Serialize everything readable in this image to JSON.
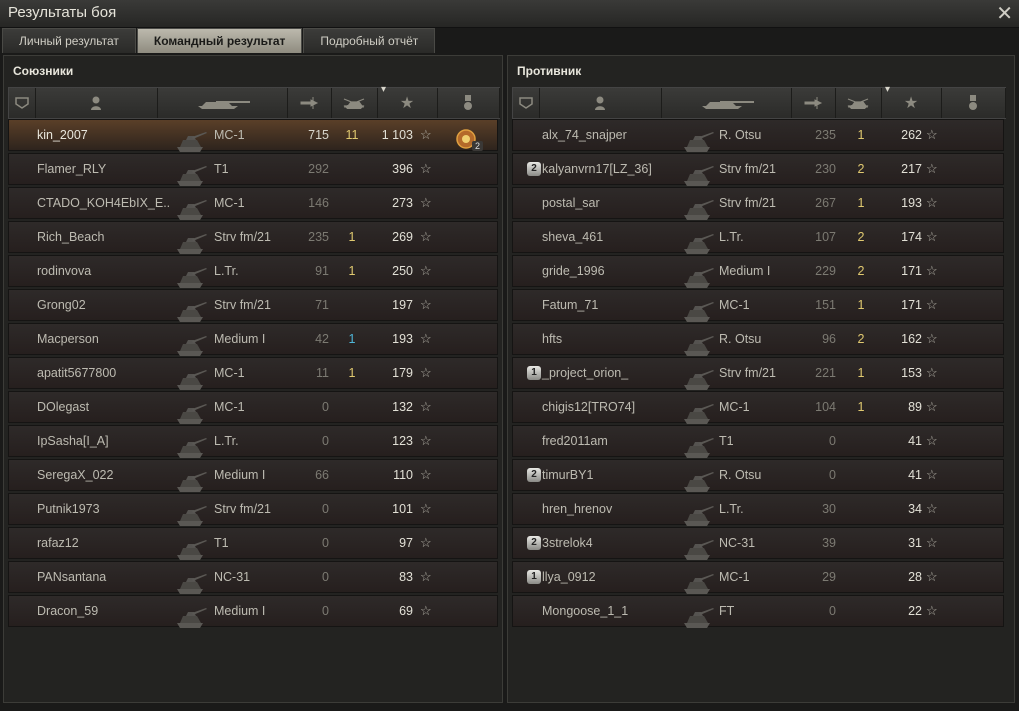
{
  "window": {
    "title": "Результаты боя"
  },
  "tabs": [
    {
      "label": "Личный результат",
      "active": false
    },
    {
      "label": "Командный результат",
      "active": true
    },
    {
      "label": "Подробный отчёт",
      "active": false
    }
  ],
  "allies": {
    "title": "Союзники",
    "rows": [
      {
        "name": "kin_2007",
        "tank": "MC-1",
        "damage": "715",
        "kills": "11",
        "xp": "1 103",
        "highlight": true,
        "medal_count": "2"
      },
      {
        "name": "Flamer_RLY",
        "tank": "T1",
        "damage": "292",
        "kills": "",
        "xp": "396"
      },
      {
        "name": "CTADO_KOH4EbIX_E..",
        "tank": "MC-1",
        "damage": "146",
        "kills": "",
        "xp": "273"
      },
      {
        "name": "Rich_Beach",
        "tank": "Strv fm/21",
        "damage": "235",
        "kills": "1",
        "xp": "269"
      },
      {
        "name": "rodinvova",
        "tank": "L.Tr.",
        "damage": "91",
        "kills": "1",
        "xp": "250"
      },
      {
        "name": "Grong02",
        "tank": "Strv fm/21",
        "damage": "71",
        "kills": "",
        "xp": "197"
      },
      {
        "name": "Macperson",
        "tank": "Medium I",
        "damage": "42",
        "kills": "1",
        "xp": "193",
        "kills_cyan": true
      },
      {
        "name": "apatit5677800",
        "tank": "MC-1",
        "damage": "11",
        "kills": "1",
        "xp": "179"
      },
      {
        "name": "DOlegast",
        "tank": "MC-1",
        "damage": "0",
        "kills": "",
        "xp": "132"
      },
      {
        "name": "IpSasha[I_A]",
        "tank": "L.Tr.",
        "damage": "0",
        "kills": "",
        "xp": "123"
      },
      {
        "name": "SeregaX_022",
        "tank": "Medium I",
        "damage": "66",
        "kills": "",
        "xp": "110"
      },
      {
        "name": "Putnik1973",
        "tank": "Strv fm/21",
        "damage": "0",
        "kills": "",
        "xp": "101"
      },
      {
        "name": "rafaz12",
        "tank": "T1",
        "damage": "0",
        "kills": "",
        "xp": "97"
      },
      {
        "name": "PANsantana",
        "tank": "NC-31",
        "damage": "0",
        "kills": "",
        "xp": "83"
      },
      {
        "name": "Dracon_59",
        "tank": "Medium I",
        "damage": "0",
        "kills": "",
        "xp": "69"
      }
    ]
  },
  "enemies": {
    "title": "Противник",
    "rows": [
      {
        "name": "alx_74_snajper",
        "tank": "R. Otsu",
        "damage": "235",
        "kills": "1",
        "xp": "262",
        "badge": ""
      },
      {
        "name": "kalyanvrn17[LZ_36]",
        "tank": "Strv fm/21",
        "damage": "230",
        "kills": "2",
        "xp": "217",
        "badge": "2"
      },
      {
        "name": "postal_sar",
        "tank": "Strv fm/21",
        "damage": "267",
        "kills": "1",
        "xp": "193",
        "badge": ""
      },
      {
        "name": "sheva_461",
        "tank": "L.Tr.",
        "damage": "107",
        "kills": "2",
        "xp": "174",
        "badge": ""
      },
      {
        "name": "gride_1996",
        "tank": "Medium I",
        "damage": "229",
        "kills": "2",
        "xp": "171",
        "badge": ""
      },
      {
        "name": "Fatum_71",
        "tank": "MC-1",
        "damage": "151",
        "kills": "1",
        "xp": "171",
        "badge": ""
      },
      {
        "name": "hfts",
        "tank": "R. Otsu",
        "damage": "96",
        "kills": "2",
        "xp": "162",
        "badge": ""
      },
      {
        "name": "_project_orion_",
        "tank": "Strv fm/21",
        "damage": "221",
        "kills": "1",
        "xp": "153",
        "badge": "1"
      },
      {
        "name": "chigis12[TRO74]",
        "tank": "MC-1",
        "damage": "104",
        "kills": "1",
        "xp": "89",
        "badge": ""
      },
      {
        "name": "fred2011am",
        "tank": "T1",
        "damage": "0",
        "kills": "",
        "xp": "41",
        "badge": ""
      },
      {
        "name": "timurBY1",
        "tank": "R. Otsu",
        "damage": "0",
        "kills": "",
        "xp": "41",
        "badge": "2"
      },
      {
        "name": "hren_hrenov",
        "tank": "L.Tr.",
        "damage": "30",
        "kills": "",
        "xp": "34",
        "badge": ""
      },
      {
        "name": "3strelok4",
        "tank": "NC-31",
        "damage": "39",
        "kills": "",
        "xp": "31",
        "badge": "2"
      },
      {
        "name": "llya_0912",
        "tank": "MC-1",
        "damage": "29",
        "kills": "",
        "xp": "28",
        "badge": "1"
      },
      {
        "name": "Mongoose_1_1",
        "tank": "FT",
        "damage": "0",
        "kills": "",
        "xp": "22",
        "badge": ""
      }
    ]
  },
  "columns": [
    "squad-icon",
    "player-icon",
    "tank-icon",
    "damage-icon",
    "kills-icon",
    "xp-star-icon",
    "medal-icon"
  ],
  "colors": {
    "kills": "#e0c970",
    "kills_highlight": "#4fb6d8",
    "highlight_row": "#5a3f28"
  }
}
